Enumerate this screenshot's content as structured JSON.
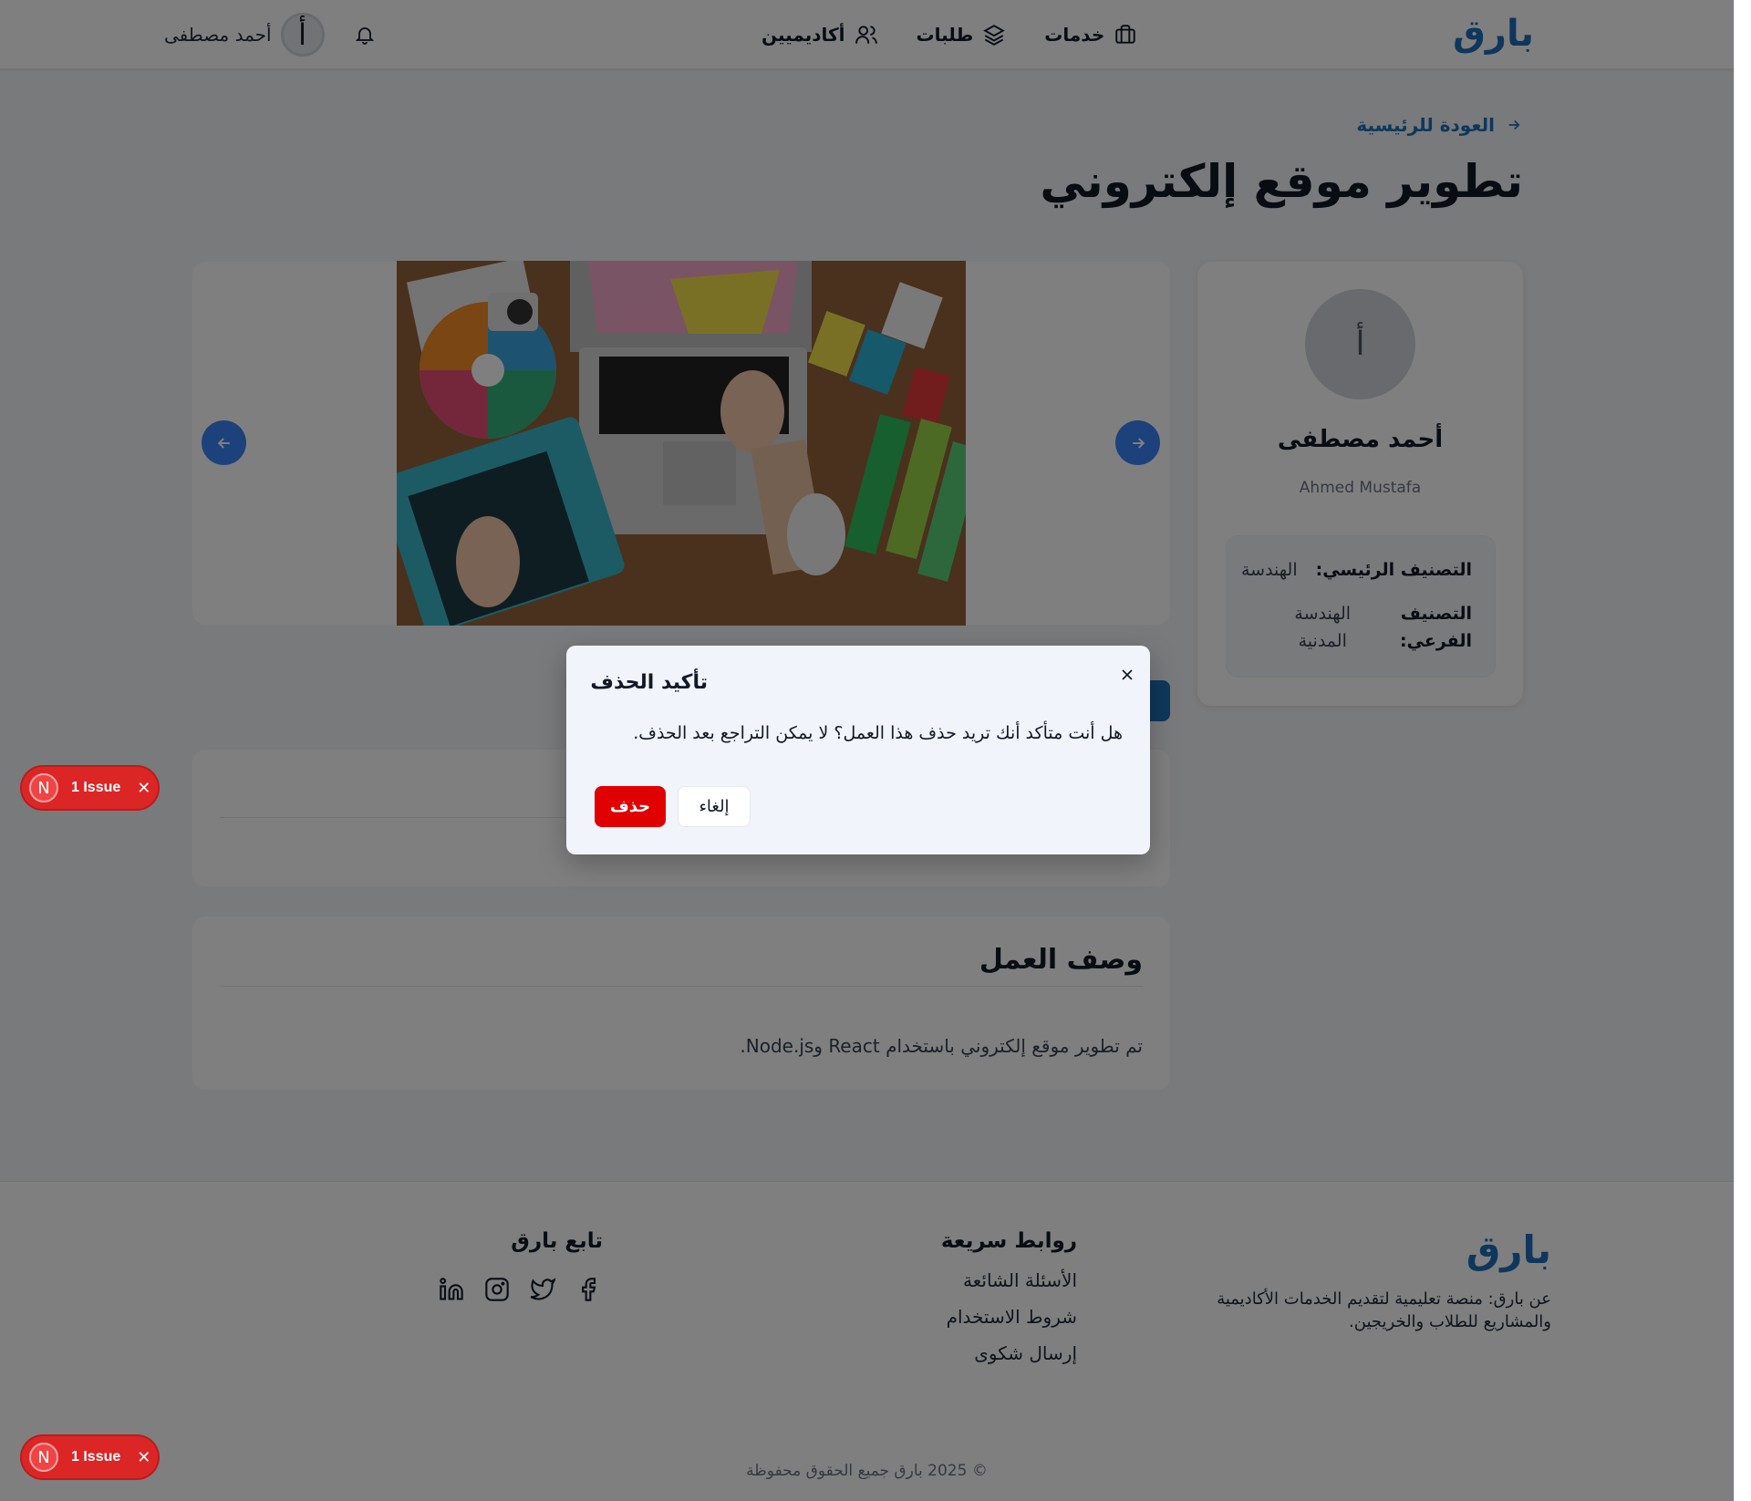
{
  "header": {
    "logo": "بارق",
    "nav": [
      {
        "label": "خدمات",
        "icon": "briefcase-icon"
      },
      {
        "label": "طلبات",
        "icon": "layers-icon"
      },
      {
        "label": "أكاديميين",
        "icon": "users-icon"
      }
    ],
    "user_name": "أحمد مصطفى",
    "avatar_letter": "أ"
  },
  "main": {
    "back_link": "العودة للرئيسية",
    "title": "تطوير موقع إلكتروني",
    "profile": {
      "avatar_letter": "أ",
      "name": "أحمد مصطفى",
      "name_en": "Ahmed Mustafa",
      "main_category_label": "التصنيف الرئيسي:",
      "main_category_value": "الهندسة",
      "sub_category_label_1": "التصنيف",
      "sub_category_label_2": "الفرعي:",
      "sub_category_value_1": "الهندسة",
      "sub_category_value_2": "المدنية"
    },
    "description": {
      "title": "وصف العمل",
      "text": "تم تطوير موقع إلكتروني باستخدام React وNode.js."
    }
  },
  "modal": {
    "title": "تأكيد الحذف",
    "body": "هل أنت متأكد أنك تريد حذف هذا العمل؟ لا يمكن التراجع بعد الحذف.",
    "delete_label": "حذف",
    "cancel_label": "إلغاء"
  },
  "footer": {
    "logo": "بارق",
    "about": "عن بارق: منصة تعليمية لتقديم الخدمات الأكاديمية والمشاريع للطلاب والخريجين.",
    "quick_links_title": "روابط سريعة",
    "quick_links": [
      "الأسئلة الشائعة",
      "شروط الاستخدام",
      "إرسال شكوى"
    ],
    "follow_title": "تابع بارق",
    "socials": [
      "facebook-icon",
      "twitter-icon",
      "instagram-icon",
      "linkedin-icon"
    ],
    "copyright": "© 2025 بارق جميع الحقوق محفوظة"
  },
  "dev_badges": [
    {
      "letter": "N",
      "label": "1 Issue"
    },
    {
      "letter": "N",
      "label": "1 Issue"
    }
  ],
  "colors": {
    "brand": "#1e6fb8",
    "danger": "#e00000",
    "issue_badge": "#dc2626"
  }
}
